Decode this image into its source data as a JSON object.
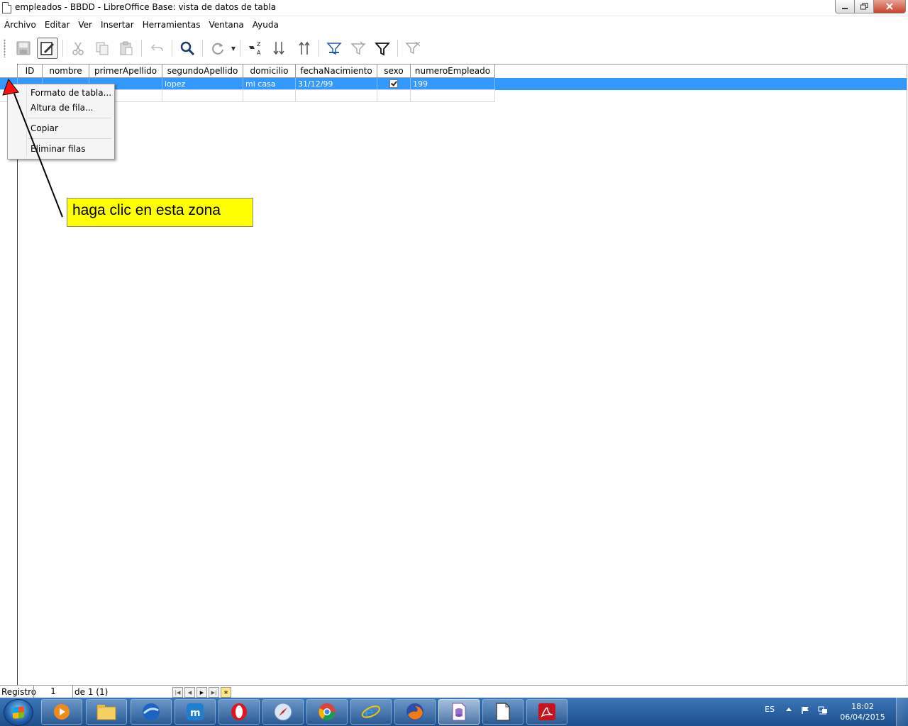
{
  "window": {
    "title": "empleados - BBDD - LibreOffice Base: vista de datos de tabla"
  },
  "menubar": {
    "items": [
      "Archivo",
      "Editar",
      "Ver",
      "Insertar",
      "Herramientas",
      "Ventana",
      "Ayuda"
    ]
  },
  "toolbar": {
    "icons": [
      "save-icon",
      "edit-mode-icon",
      "cut-icon",
      "copy-icon",
      "paste-icon",
      "undo-icon",
      "search-icon",
      "refresh-icon",
      "sort-icon",
      "sort-ascending-icon",
      "sort-descending-icon",
      "autofilter-icon",
      "apply-filter-icon",
      "standard-filter-icon",
      "reset-filter-icon"
    ]
  },
  "table": {
    "columns": [
      "ID",
      "nombre",
      "primerApellido",
      "segundoApellido",
      "domicilio",
      "fechaNacimiento",
      "sexo",
      "numeroEmpleado"
    ],
    "rows": [
      {
        "segundoApellido": "lopez",
        "domicilio": "mi casa",
        "fechaNacimiento": "31/12/99",
        "sexo": true,
        "numeroEmpleado": "199"
      }
    ]
  },
  "context_menu": {
    "items": [
      "Formato de tabla...",
      "Altura de fila...",
      "Copiar",
      "Eliminar filas"
    ]
  },
  "callout": {
    "text": "haga clic en esta zona",
    "color": "#ffff00"
  },
  "statusbar": {
    "label": "Registro",
    "current": "1",
    "of_text": "de 1 (1)"
  },
  "taskbar": {
    "apps": [
      "windows-media-player-icon",
      "windows-explorer-icon",
      "google-earth-icon",
      "maxthon-icon",
      "opera-icon",
      "safari-icon",
      "chrome-icon",
      "internet-explorer-icon",
      "firefox-icon",
      "libreoffice-base-icon",
      "libreoffice-icon",
      "adobe-reader-icon"
    ],
    "language": "ES",
    "time": "18:02",
    "date": "06/04/2015"
  },
  "colors": {
    "selection": "#3399ff",
    "taskbar": "#245c9f"
  }
}
